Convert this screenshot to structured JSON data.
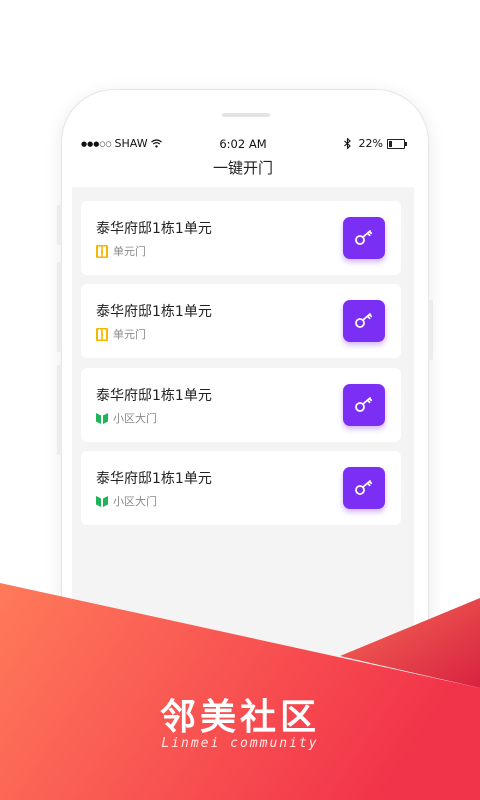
{
  "status_bar": {
    "carrier": "SHAW",
    "signal_dots": "●●●○○",
    "time": "6:02 AM",
    "battery": "22%",
    "battery_level": 0.22
  },
  "nav": {
    "title": "一键开门"
  },
  "doors": [
    {
      "name": "泰华府邸1栋1单元",
      "type": "单元门",
      "icon": "unit-door-icon",
      "icon_color": "#f5b800"
    },
    {
      "name": "泰华府邸1栋1单元",
      "type": "单元门",
      "icon": "unit-door-icon",
      "icon_color": "#f5b800"
    },
    {
      "name": "泰华府邸1栋1单元",
      "type": "小区大门",
      "icon": "community-gate-icon",
      "icon_color": "#1fb35a"
    },
    {
      "name": "泰华府邸1栋1单元",
      "type": "小区大门",
      "icon": "community-gate-icon",
      "icon_color": "#1fb35a"
    }
  ],
  "key_button": {
    "icon": "key-icon",
    "color": "#7b2ff5"
  },
  "brand": {
    "name": "邻美社区",
    "tagline": "Linmei community"
  },
  "colors": {
    "banner_start": "#ff7a5a",
    "banner_end": "#f2344a",
    "background": "#f4f4f4"
  }
}
